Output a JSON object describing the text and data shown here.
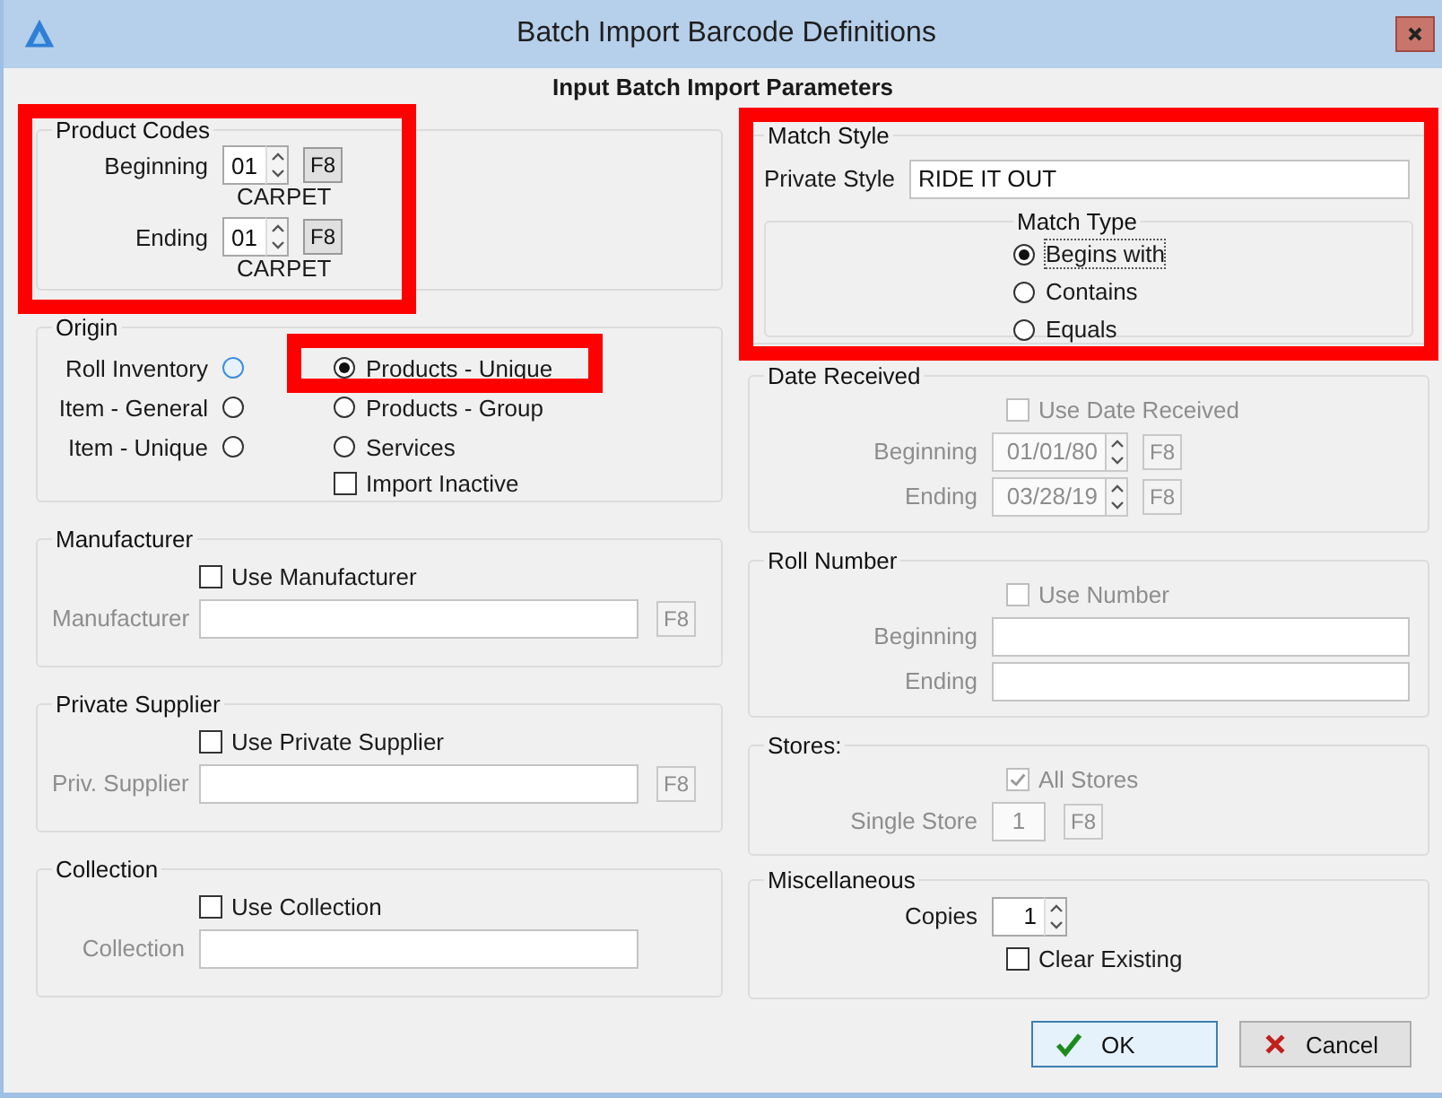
{
  "window": {
    "title": "Batch Import Barcode Definitions"
  },
  "heading": "Input Batch Import Parameters",
  "product_codes": {
    "title": "Product Codes",
    "highlighted": true,
    "rows": [
      {
        "label": "Beginning",
        "value": "01",
        "button": "F8",
        "caption": "CARPET"
      },
      {
        "label": "Ending",
        "value": "01",
        "button": "F8",
        "caption": "CARPET"
      }
    ]
  },
  "origin": {
    "title": "Origin",
    "left_options": [
      {
        "label": "Roll Inventory",
        "selected": false,
        "hovered": true
      },
      {
        "label": "Item - General",
        "selected": false,
        "hovered": false
      },
      {
        "label": "Item - Unique",
        "selected": false,
        "hovered": false
      }
    ],
    "right_options": [
      {
        "label": "Products - Unique",
        "selected": true,
        "highlighted": true
      },
      {
        "label": "Products - Group",
        "selected": false,
        "highlighted": false
      },
      {
        "label": "Services",
        "selected": false,
        "highlighted": false
      }
    ],
    "checkbox": {
      "label": "Import Inactive",
      "checked": false,
      "disabled": false
    }
  },
  "manufacturer": {
    "title": "Manufacturer",
    "checkbox": {
      "label": "Use Manufacturer",
      "checked": false,
      "disabled": false
    },
    "field": {
      "label": "Manufacturer",
      "disabled": true,
      "button": "F8"
    }
  },
  "private_supplier": {
    "title": "Private Supplier",
    "checkbox": {
      "label": "Use Private Supplier",
      "checked": false,
      "disabled": false
    },
    "field": {
      "label": "Priv. Supplier",
      "disabled": true,
      "button": "F8"
    }
  },
  "collection": {
    "title": "Collection",
    "checkbox": {
      "label": "Use Collection",
      "checked": false,
      "disabled": false
    },
    "field": {
      "label": "Collection",
      "disabled": true
    }
  },
  "match_style": {
    "title": "Match Style",
    "highlighted": true,
    "field": {
      "label": "Private Style",
      "value": "RIDE IT OUT"
    },
    "match_type": {
      "title": "Match Type",
      "options": [
        {
          "label": "Begins with",
          "selected": true,
          "focused": true
        },
        {
          "label": "Contains",
          "selected": false,
          "focused": false
        },
        {
          "label": "Equals",
          "selected": false,
          "focused": false
        }
      ]
    }
  },
  "date_received": {
    "title": "Date Received",
    "checkbox": {
      "label": "Use Date Received",
      "checked": false,
      "disabled": true
    },
    "rows": [
      {
        "label": "Beginning",
        "value": "01/01/80",
        "button": "F8",
        "disabled": true
      },
      {
        "label": "Ending",
        "value": "03/28/19",
        "button": "F8",
        "disabled": true
      }
    ]
  },
  "roll_number": {
    "title": "Roll Number",
    "checkbox": {
      "label": "Use Number",
      "checked": false,
      "disabled": true
    },
    "rows": [
      {
        "label": "Beginning",
        "disabled": true
      },
      {
        "label": "Ending",
        "disabled": true
      }
    ]
  },
  "stores": {
    "title": "Stores:",
    "checkbox": {
      "label": "All Stores",
      "checked": true,
      "disabled": true
    },
    "field": {
      "label": "Single Store",
      "value": "1",
      "button": "F8",
      "disabled": true
    }
  },
  "miscellaneous": {
    "title": "Miscellaneous",
    "field": {
      "label": "Copies",
      "value": "1",
      "disabled": false
    },
    "checkbox": {
      "label": "Clear Existing",
      "checked": false,
      "disabled": false
    }
  },
  "buttons": [
    {
      "label": "OK",
      "kind": "ok",
      "default": true
    },
    {
      "label": "Cancel",
      "kind": "cancel",
      "default": false
    }
  ]
}
